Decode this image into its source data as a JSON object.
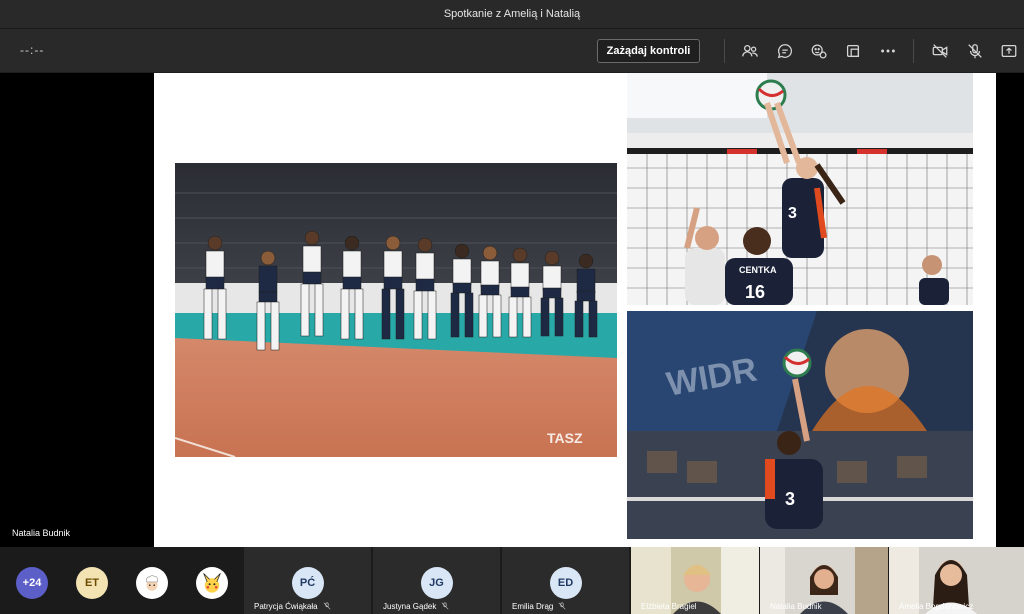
{
  "window": {
    "title": "Spotkanie z Amelią i Natalią"
  },
  "toolbar": {
    "timer": "--:--",
    "request_control_label": "Zażądaj kontroli",
    "icons": [
      "people-icon",
      "chat-icon",
      "reactions-icon",
      "rooms-icon",
      "more-icon",
      "camera-off-icon",
      "mic-off-icon",
      "share-icon"
    ]
  },
  "stage": {
    "presenter_name": "Natalia Budnik",
    "photos": [
      {
        "subject": "team-lineup",
        "watermark": "TASZ"
      },
      {
        "subject": "net-block",
        "jersey_numbers": [
          "3",
          "16"
        ],
        "sponsor": "CENTKA"
      },
      {
        "subject": "serve",
        "jersey_number": "3"
      }
    ]
  },
  "participants": {
    "overflow_count": "+24",
    "avatars": [
      {
        "initials": "ET",
        "bg": "#f3e3b3",
        "fg": "#6b4a00"
      },
      {
        "initials": "",
        "bg": "#ffffff",
        "fg": "#000",
        "kind": "chef-avatar"
      },
      {
        "initials": "",
        "bg": "#ffd24a",
        "fg": "#000",
        "kind": "pikachu-avatar"
      }
    ],
    "tiles": [
      {
        "initials": "PĆ",
        "name": "Patrycja Ćwiąkała",
        "bg": "#d8e6f6",
        "fg": "#223a63"
      },
      {
        "initials": "JG",
        "name": "Justyna Gądek",
        "bg": "#d8e6f6",
        "fg": "#223a63"
      },
      {
        "initials": "ED",
        "name": "Emilia Drąg",
        "bg": "#d8e6f6",
        "fg": "#223a63"
      }
    ],
    "video_tiles": [
      {
        "name": "Elżbieta Bragiel"
      },
      {
        "name": "Natalia Budnik"
      },
      {
        "name": "Amelia Bogdanowicz"
      }
    ]
  },
  "colors": {
    "accent": "#5b5fc7",
    "toolbar_bg": "#292929",
    "stage_bg": "#000000"
  }
}
